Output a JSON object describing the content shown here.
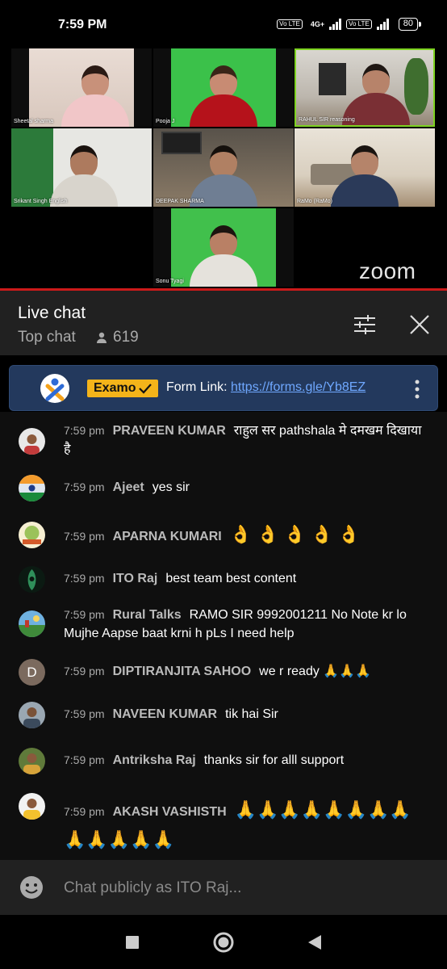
{
  "status_bar": {
    "time": "7:59 PM",
    "volte1": "Vo LTE",
    "network": "4G+",
    "volte2": "Vo LTE",
    "battery": "80"
  },
  "zoom": {
    "logo_text": "zoom",
    "participants": [
      {
        "name": "Sheetal sharma"
      },
      {
        "name": "Pooja J"
      },
      {
        "name": "RAHUL SIR reasoning"
      },
      {
        "name": "Srikant Singh English"
      },
      {
        "name": "DEEPAK SHARMA"
      },
      {
        "name": "RaMo (RaMo)"
      },
      {
        "name": "Sonu Tyagi"
      }
    ]
  },
  "chat_header": {
    "title": "Live chat",
    "mode": "Top chat",
    "viewer_count": "619"
  },
  "pinned": {
    "badge": "Examo",
    "text": "Form Link: ",
    "link": "https://forms.gle/Yb8EZ"
  },
  "messages": [
    {
      "time": "7:59 pm",
      "author": "PRAVEEN KUMAR",
      "text": "राहुल सर pathshala मे दमखम दिखाया है"
    },
    {
      "time": "7:59 pm",
      "author": "Ajeet",
      "text": "yes sir"
    },
    {
      "time": "7:59 pm",
      "author": "APARNA KUMARI",
      "text": "👌 👌 👌 👌 👌"
    },
    {
      "time": "7:59 pm",
      "author": "ITO Raj",
      "text": "best team best content"
    },
    {
      "time": "7:59 pm",
      "author": "Rural Talks",
      "text": "RAMO SIR 9992001211 No Note kr lo Mujhe Aapse baat krni h pLs I need help"
    },
    {
      "time": "7:59 pm",
      "author": "DIPTIRANJITA SAHOO",
      "text": "we r ready 🙏🙏🙏",
      "avatar_letter": "D"
    },
    {
      "time": "7:59 pm",
      "author": "NAVEEN KUMAR",
      "text": "tik hai Sir"
    },
    {
      "time": "7:59 pm",
      "author": "Antriksha Raj",
      "text": "thanks sir for alll support"
    },
    {
      "time": "7:59 pm",
      "author": "AKASH VASHISTH",
      "text": "🙏🙏🙏🙏🙏🙏🙏🙏🙏🙏🙏🙏🙏"
    }
  ],
  "input": {
    "placeholder": "Chat publicly as ITO Raj..."
  },
  "colors": {
    "accent_red": "#cc1a1a",
    "pinned_bg": "#23395d",
    "badge_yellow": "#f4b41a",
    "link_blue": "#6fa8ff"
  }
}
